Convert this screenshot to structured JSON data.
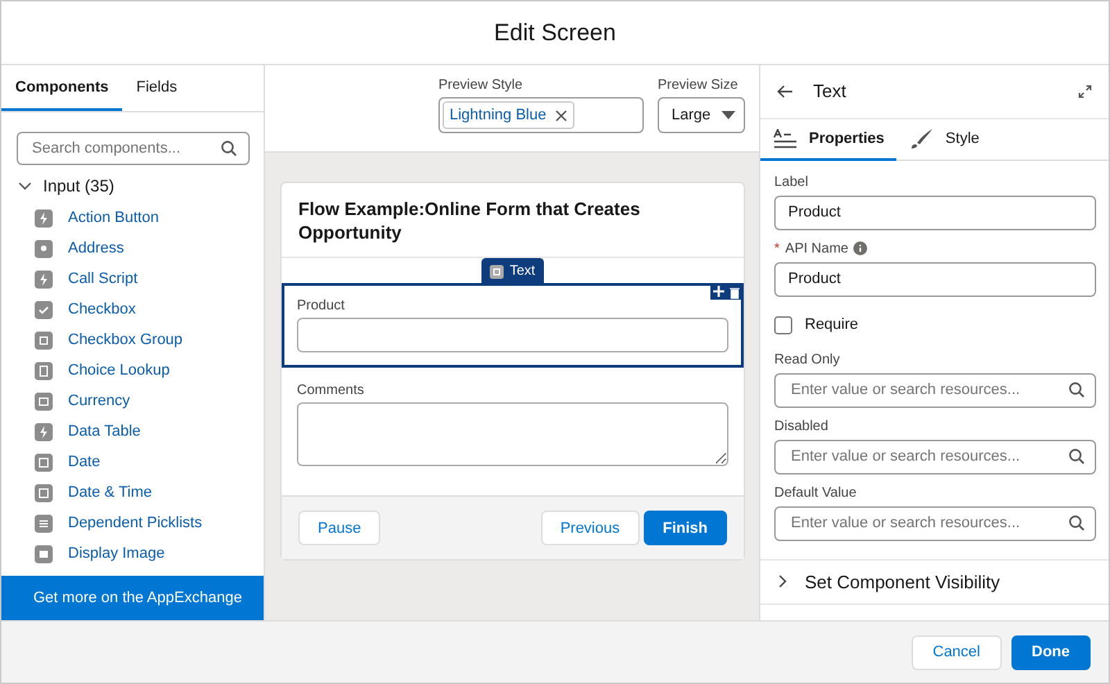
{
  "window": {
    "title": "Edit Screen"
  },
  "left_tabs": [
    {
      "label": "Components",
      "selected": true
    },
    {
      "label": "Fields",
      "selected": false
    }
  ],
  "search": {
    "placeholder": "Search components..."
  },
  "group": {
    "label": "Input (35)",
    "expanded": true
  },
  "components": [
    {
      "label": "Action Button",
      "kind": "bolt"
    },
    {
      "label": "Address",
      "kind": "pin"
    },
    {
      "label": "Call Script",
      "kind": "bolt"
    },
    {
      "label": "Checkbox",
      "kind": "check"
    },
    {
      "label": "Checkbox Group",
      "kind": "group"
    },
    {
      "label": "Choice Lookup",
      "kind": "lookup"
    },
    {
      "label": "Currency",
      "kind": "currency"
    },
    {
      "label": "Data Table",
      "kind": "bolt"
    },
    {
      "label": "Date",
      "kind": "date"
    },
    {
      "label": "Date & Time",
      "kind": "date"
    },
    {
      "label": "Dependent Picklists",
      "kind": "list"
    },
    {
      "label": "Display Image",
      "kind": "image"
    }
  ],
  "appexchange": "Get more on the AppExchange",
  "preview_style": {
    "label": "Preview Style",
    "pill": "Lightning Blue"
  },
  "preview_size": {
    "label": "Preview Size",
    "value": "Large"
  },
  "screen": {
    "title": "Flow Example:Online Form that Creates Opportunity",
    "selected_tag": "Text",
    "fields": [
      {
        "label": "Product",
        "kind": "input",
        "selected": true
      },
      {
        "label": "Comments",
        "kind": "textarea",
        "selected": false
      }
    ],
    "buttons": [
      {
        "label": "Pause",
        "primary": false
      },
      {
        "label": "Previous",
        "primary": false
      },
      {
        "label": "Finish",
        "primary": true
      }
    ]
  },
  "panel": {
    "title": "Text",
    "tabs": [
      {
        "label": "Properties",
        "selected": true
      },
      {
        "label": "Style",
        "selected": false
      }
    ],
    "label_field": {
      "label": "Label",
      "value": "Product"
    },
    "api_field": {
      "label": "API Name",
      "value": "Product",
      "required_mark": "*"
    },
    "require": {
      "label": "Require",
      "checked": false
    },
    "resource_fields": [
      {
        "label": "Read Only",
        "placeholder": "Enter value or search resources..."
      },
      {
        "label": "Disabled",
        "placeholder": "Enter value or search resources..."
      },
      {
        "label": "Default Value",
        "placeholder": "Enter value or search resources..."
      }
    ],
    "section": {
      "label": "Set Component Visibility",
      "expanded": false
    }
  },
  "footer": [
    {
      "label": "Cancel",
      "primary": false
    },
    {
      "label": "Done",
      "primary": true
    }
  ]
}
